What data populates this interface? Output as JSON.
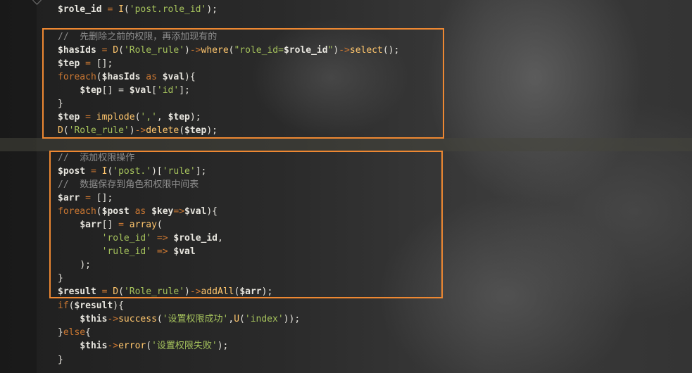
{
  "lines": [
    [
      [
        "$role_id",
        "var"
      ],
      [
        " = ",
        "op"
      ],
      [
        "I",
        "fn"
      ],
      [
        "(",
        "plain"
      ],
      [
        "'post.role_id'",
        "str"
      ],
      [
        ");",
        "plain"
      ]
    ],
    [
      [
        "//  先删除之前的权限，再添加现有的",
        "cm"
      ]
    ],
    [
      [
        "$hasIds",
        "var"
      ],
      [
        " = ",
        "op"
      ],
      [
        "D",
        "fn"
      ],
      [
        "(",
        "plain"
      ],
      [
        "'Role_rule'",
        "str"
      ],
      [
        ")",
        "plain"
      ],
      [
        "->",
        "op"
      ],
      [
        "where",
        "fn"
      ],
      [
        "(",
        "plain"
      ],
      [
        "\"role_id=",
        "str"
      ],
      [
        "$role_id",
        "var"
      ],
      [
        "\"",
        "str"
      ],
      [
        ")",
        "plain"
      ],
      [
        "->",
        "op"
      ],
      [
        "select",
        "fn"
      ],
      [
        "();",
        "plain"
      ]
    ],
    [
      [
        "$tep",
        "var"
      ],
      [
        " = ",
        "op"
      ],
      [
        "[];",
        "plain"
      ]
    ],
    [
      [
        "foreach",
        "kw"
      ],
      [
        "(",
        "plain"
      ],
      [
        "$hasIds",
        "var"
      ],
      [
        " as ",
        "kw"
      ],
      [
        "$val",
        "var"
      ],
      [
        "){",
        "plain"
      ]
    ],
    [
      [
        "    ",
        "plain"
      ],
      [
        "$tep",
        "var"
      ],
      [
        "[] = ",
        "plain"
      ],
      [
        "$val",
        "var"
      ],
      [
        "[",
        "plain"
      ],
      [
        "'id'",
        "str"
      ],
      [
        "];",
        "plain"
      ]
    ],
    [
      [
        "}",
        "plain"
      ]
    ],
    [
      [
        "$tep",
        "var"
      ],
      [
        " = ",
        "op"
      ],
      [
        "implode",
        "fn"
      ],
      [
        "(",
        "plain"
      ],
      [
        "','",
        "str"
      ],
      [
        ", ",
        "plain"
      ],
      [
        "$tep",
        "var"
      ],
      [
        ");",
        "plain"
      ]
    ],
    [
      [
        "D",
        "fn"
      ],
      [
        "(",
        "plain"
      ],
      [
        "'Role_rule'",
        "str"
      ],
      [
        ")",
        "plain"
      ],
      [
        "->",
        "op"
      ],
      [
        "delete",
        "fn"
      ],
      [
        "(",
        "plain"
      ],
      [
        "$tep",
        "var"
      ],
      [
        ");",
        "plain"
      ]
    ],
    [],
    [
      [
        "//  添加权限操作",
        "cm"
      ]
    ],
    [
      [
        "$post",
        "var"
      ],
      [
        " = ",
        "op"
      ],
      [
        "I",
        "fn"
      ],
      [
        "(",
        "plain"
      ],
      [
        "'post.'",
        "str"
      ],
      [
        ")[",
        "plain"
      ],
      [
        "'rule'",
        "str"
      ],
      [
        "];",
        "plain"
      ]
    ],
    [
      [
        "//  数据保存到角色和权限中间表",
        "cm"
      ]
    ],
    [
      [
        "$arr",
        "var"
      ],
      [
        " = ",
        "op"
      ],
      [
        "[];",
        "plain"
      ]
    ],
    [
      [
        "foreach",
        "kw"
      ],
      [
        "(",
        "plain"
      ],
      [
        "$post",
        "var"
      ],
      [
        " as ",
        "kw"
      ],
      [
        "$key",
        "var"
      ],
      [
        "=>",
        "op"
      ],
      [
        "$val",
        "var"
      ],
      [
        "){",
        "plain"
      ]
    ],
    [
      [
        "    ",
        "plain"
      ],
      [
        "$arr",
        "var"
      ],
      [
        "[] ",
        "plain"
      ],
      [
        "= ",
        "op"
      ],
      [
        "array",
        "fn"
      ],
      [
        "(",
        "plain"
      ]
    ],
    [
      [
        "        ",
        "plain"
      ],
      [
        "'role_id'",
        "str"
      ],
      [
        " => ",
        "op"
      ],
      [
        "$role_id",
        "var"
      ],
      [
        ",",
        "plain"
      ]
    ],
    [
      [
        "        ",
        "plain"
      ],
      [
        "'rule_id'",
        "str"
      ],
      [
        " => ",
        "op"
      ],
      [
        "$val",
        "var"
      ]
    ],
    [
      [
        "    ",
        "plain"
      ],
      [
        ");",
        "plain"
      ]
    ],
    [
      [
        "}",
        "plain"
      ]
    ],
    [
      [
        "$result",
        "var"
      ],
      [
        " = ",
        "op"
      ],
      [
        "D",
        "fn"
      ],
      [
        "(",
        "plain"
      ],
      [
        "'Role_rule'",
        "str"
      ],
      [
        ")",
        "plain"
      ],
      [
        "->",
        "op"
      ],
      [
        "addAll",
        "fn"
      ],
      [
        "(",
        "plain"
      ],
      [
        "$arr",
        "var"
      ],
      [
        ");",
        "plain"
      ]
    ],
    [
      [
        "if",
        "kw"
      ],
      [
        "(",
        "plain"
      ],
      [
        "$result",
        "var"
      ],
      [
        "){",
        "plain"
      ]
    ],
    [
      [
        "    ",
        "plain"
      ],
      [
        "$this",
        "var"
      ],
      [
        "->",
        "op"
      ],
      [
        "success",
        "fn"
      ],
      [
        "(",
        "plain"
      ],
      [
        "'设置权限成功'",
        "str"
      ],
      [
        ",",
        "plain"
      ],
      [
        "U",
        "fn"
      ],
      [
        "(",
        "plain"
      ],
      [
        "'index'",
        "str"
      ],
      [
        "));",
        "plain"
      ]
    ],
    [
      [
        "}",
        "plain"
      ],
      [
        "else",
        "kw"
      ],
      [
        "{",
        "plain"
      ]
    ],
    [
      [
        "    ",
        "plain"
      ],
      [
        "$this",
        "var"
      ],
      [
        "->",
        "op"
      ],
      [
        "error",
        "fn"
      ],
      [
        "(",
        "plain"
      ],
      [
        "'设置权限失败'",
        "str"
      ],
      [
        ");",
        "plain"
      ]
    ],
    [
      [
        "}",
        "plain"
      ]
    ]
  ],
  "colors": {
    "variable": "#e8e6df",
    "operator": "#cc7832",
    "string": "#a5c25c",
    "function": "#ffc66d",
    "comment": "#8d8d8d",
    "highlight_border": "#ee8832"
  }
}
